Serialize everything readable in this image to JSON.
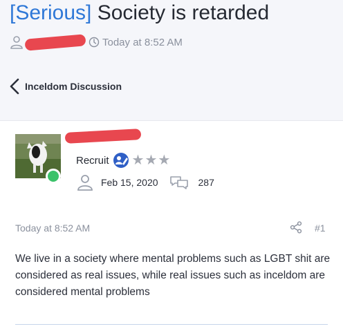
{
  "thread": {
    "prefix": "[Serious]",
    "title": " Society is retarded",
    "timestamp": "Today at 8:52 AM",
    "back_label": "Inceldom Discussion"
  },
  "post": {
    "user_title": "Recruit",
    "rank_stars": "★★★",
    "join_date": "Feb 15, 2020",
    "message_count": "287",
    "timestamp": "Today at 8:52 AM",
    "post_number": "#1",
    "body": "We live in a society where mental problems such as LGBT shit are considered as real issues, while real issues such as inceldom are considered mental problems"
  },
  "colors": {
    "accent_blue": "#2f78d7",
    "online_green": "#3bc26a",
    "redaction_red": "#e8474f",
    "muted_gray": "#8a909d"
  },
  "icons": [
    "user-icon",
    "clock-icon",
    "chevron-left-icon",
    "badge-icon",
    "message-icon",
    "share-icon"
  ]
}
